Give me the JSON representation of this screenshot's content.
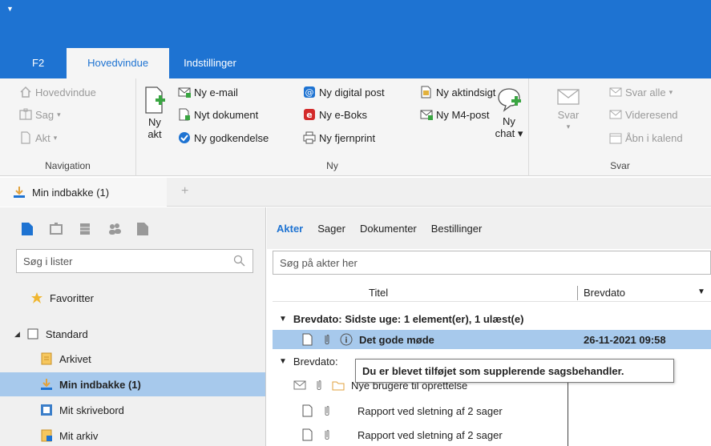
{
  "ribbon_tabs": [
    "F2",
    "Hovedvindue",
    "Indstillinger"
  ],
  "navigation": {
    "label": "Navigation",
    "items": [
      "Hovedvindue",
      "Sag",
      "Akt"
    ],
    "new_act_label_1": "Ny",
    "new_act_label_2": "akt"
  },
  "ny_group": {
    "label": "Ny",
    "col1": [
      "Ny e-mail",
      "Nyt dokument",
      "Ny godkendelse"
    ],
    "col2": [
      "Ny digital post",
      "Ny e-Boks",
      "Ny fjernprint"
    ],
    "col3": [
      "Ny aktindsigt",
      "Ny M4-post"
    ],
    "chat_1": "Ny",
    "chat_2": "chat"
  },
  "svar_group": {
    "label": "Svar",
    "svar_btn": "Svar",
    "items": [
      "Svar alle",
      "Videresend",
      "Åbn i kalend"
    ]
  },
  "doc_tab": "Min indbakke (1)",
  "left": {
    "search_placeholder": "Søg i lister",
    "favorites": "Favoritter",
    "standard": "Standard",
    "items": [
      "Arkivet",
      "Min indbakke (1)",
      "Mit skrivebord",
      "Mit arkiv"
    ]
  },
  "right": {
    "tabs": [
      "Akter",
      "Sager",
      "Dokumenter",
      "Bestillinger"
    ],
    "search_placeholder": "Søg på akter her",
    "col_title": "Titel",
    "col_date": "Brevdato",
    "group1": "Brevdato: Sidste uge: 1 element(er), 1 ulæst(e)",
    "selected_title": "Det gode møde",
    "selected_date": "26-11-2021 09:58",
    "group2": "Brevdato:",
    "rows": [
      "Nye brugere til oprettelse",
      "Rapport ved sletning af 2 sager",
      "Rapport ved sletning af 2 sager"
    ],
    "tooltip": "Du er blevet tilføjet som supplerende sagsbehandler."
  },
  "colors": {
    "brand": "#1e73d2",
    "selection": "#a7c9ec"
  }
}
